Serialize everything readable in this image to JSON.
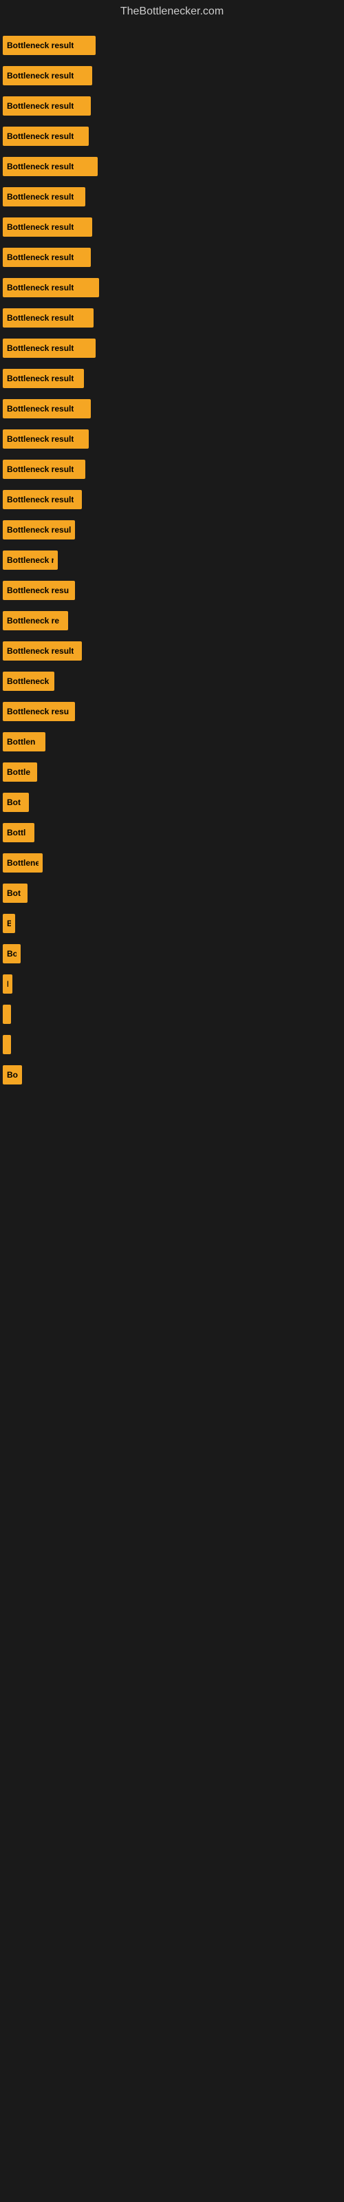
{
  "site": {
    "title": "TheBottlenecker.com"
  },
  "bars": [
    {
      "id": 1,
      "label": "Bottleneck result",
      "width": 135
    },
    {
      "id": 2,
      "label": "Bottleneck result",
      "width": 130
    },
    {
      "id": 3,
      "label": "Bottleneck result",
      "width": 128
    },
    {
      "id": 4,
      "label": "Bottleneck result",
      "width": 125
    },
    {
      "id": 5,
      "label": "Bottleneck result",
      "width": 138
    },
    {
      "id": 6,
      "label": "Bottleneck result",
      "width": 120
    },
    {
      "id": 7,
      "label": "Bottleneck result",
      "width": 130
    },
    {
      "id": 8,
      "label": "Bottleneck result",
      "width": 128
    },
    {
      "id": 9,
      "label": "Bottleneck result",
      "width": 140
    },
    {
      "id": 10,
      "label": "Bottleneck result",
      "width": 132
    },
    {
      "id": 11,
      "label": "Bottleneck result",
      "width": 135
    },
    {
      "id": 12,
      "label": "Bottleneck result",
      "width": 118
    },
    {
      "id": 13,
      "label": "Bottleneck result",
      "width": 128
    },
    {
      "id": 14,
      "label": "Bottleneck result",
      "width": 125
    },
    {
      "id": 15,
      "label": "Bottleneck result",
      "width": 120
    },
    {
      "id": 16,
      "label": "Bottleneck result",
      "width": 115
    },
    {
      "id": 17,
      "label": "Bottleneck result",
      "width": 105
    },
    {
      "id": 18,
      "label": "Bottleneck result",
      "width": 80
    },
    {
      "id": 19,
      "label": "Bottleneck resu",
      "width": 105
    },
    {
      "id": 20,
      "label": "Bottleneck re",
      "width": 95
    },
    {
      "id": 21,
      "label": "Bottleneck result",
      "width": 115
    },
    {
      "id": 22,
      "label": "Bottleneck",
      "width": 75
    },
    {
      "id": 23,
      "label": "Bottleneck resu",
      "width": 105
    },
    {
      "id": 24,
      "label": "Bottlen",
      "width": 62
    },
    {
      "id": 25,
      "label": "Bottle",
      "width": 50
    },
    {
      "id": 26,
      "label": "Bot",
      "width": 38
    },
    {
      "id": 27,
      "label": "Bottl",
      "width": 46
    },
    {
      "id": 28,
      "label": "Bottlene",
      "width": 58
    },
    {
      "id": 29,
      "label": "Bot",
      "width": 36
    },
    {
      "id": 30,
      "label": "B",
      "width": 18
    },
    {
      "id": 31,
      "label": "Bo",
      "width": 26
    },
    {
      "id": 32,
      "label": "B",
      "width": 14
    },
    {
      "id": 33,
      "label": "",
      "width": 10
    },
    {
      "id": 34,
      "label": "",
      "width": 8
    },
    {
      "id": 35,
      "label": "Bo",
      "width": 28
    }
  ]
}
